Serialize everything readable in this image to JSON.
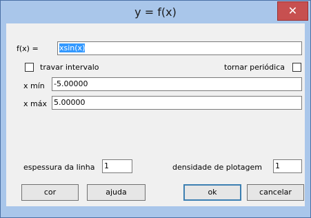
{
  "window": {
    "title": "y = f(x)",
    "close_glyph": "✕"
  },
  "function": {
    "label": "f(x) =",
    "value": "xsin(x)"
  },
  "lock_interval": {
    "label": "travar intervalo",
    "checked": false
  },
  "periodic": {
    "label": "tornar periódica",
    "checked": false
  },
  "x_min": {
    "label": "x mín",
    "value": "-5.00000"
  },
  "x_max": {
    "label": "x máx",
    "value": "5.00000"
  },
  "line_thickness": {
    "label": "espessura da linha",
    "value": "1"
  },
  "plot_density": {
    "label": "densidade de plotagem",
    "value": "1"
  },
  "buttons": {
    "color": "cor",
    "help": "ajuda",
    "ok": "ok",
    "cancel": "cancelar"
  }
}
